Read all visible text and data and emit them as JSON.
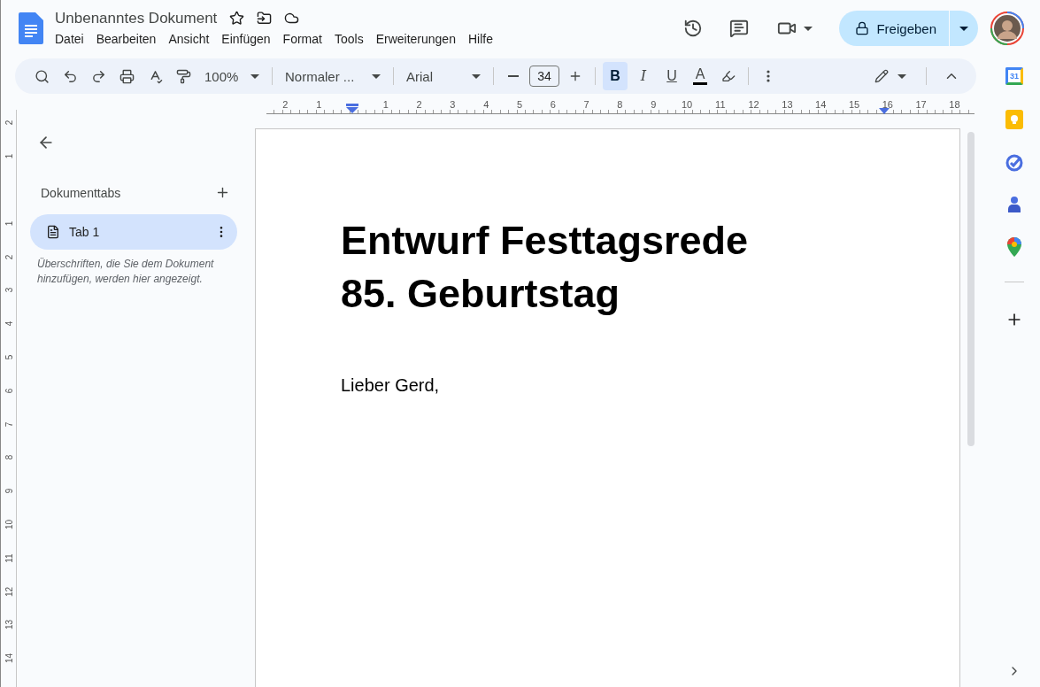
{
  "header": {
    "title": "Unbenanntes Dokument",
    "menu": [
      "Datei",
      "Bearbeiten",
      "Ansicht",
      "Einfügen",
      "Format",
      "Tools",
      "Erweiterungen",
      "Hilfe"
    ],
    "share_button": "Freigeben"
  },
  "toolbar": {
    "zoom": "100%",
    "style": "Normaler ...",
    "font": "Arial",
    "font_size": "34",
    "format_buttons": [
      {
        "label": "B",
        "kind": "bold",
        "selected": true
      },
      {
        "label": "I",
        "kind": "italic",
        "selected": false
      },
      {
        "label": "U",
        "kind": "underline",
        "selected": false
      },
      {
        "label": "A",
        "kind": "text_color",
        "selected": false
      }
    ]
  },
  "ruler": {
    "left_numbers": [
      "2",
      "1"
    ],
    "right_numbers": [
      "1",
      "2",
      "3",
      "4",
      "5",
      "6",
      "7",
      "8",
      "9",
      "10",
      "11",
      "12",
      "13",
      "14",
      "15",
      "16",
      "17",
      "18"
    ]
  },
  "vertical_ruler": {
    "top_numbers": [
      "2",
      "1"
    ],
    "numbers": [
      "1",
      "2",
      "3",
      "4",
      "5",
      "6",
      "7",
      "8",
      "9",
      "10",
      "11",
      "12",
      "13",
      "14"
    ]
  },
  "sidebar": {
    "heading": "Dokumenttabs",
    "tabs": [
      {
        "label": "Tab 1",
        "selected": true
      }
    ],
    "hint": "Überschriften, die Sie dem Dokument hinzufügen, werden hier angezeigt."
  },
  "document": {
    "heading_lines": [
      "Entwurf Festtagsrede",
      "85. Geburtstag"
    ],
    "body": "Lieber Gerd,"
  },
  "side_panel": {
    "calendar_day": "31"
  }
}
